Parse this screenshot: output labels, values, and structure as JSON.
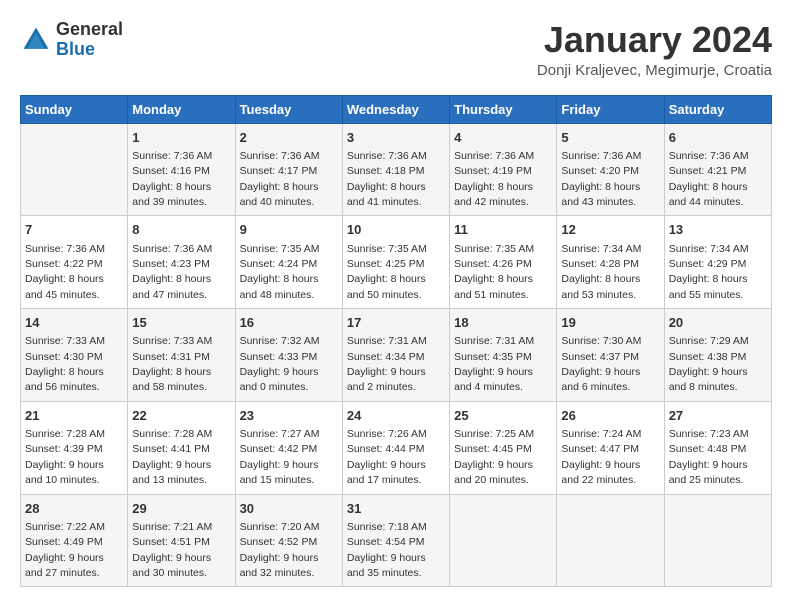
{
  "header": {
    "logo": {
      "general": "General",
      "blue": "Blue"
    },
    "title": "January 2024",
    "subtitle": "Donji Kraljevec, Megimurje, Croatia"
  },
  "weekdays": [
    "Sunday",
    "Monday",
    "Tuesday",
    "Wednesday",
    "Thursday",
    "Friday",
    "Saturday"
  ],
  "weeks": [
    [
      {
        "day": "",
        "sunrise": "",
        "sunset": "",
        "daylight": ""
      },
      {
        "day": "1",
        "sunrise": "Sunrise: 7:36 AM",
        "sunset": "Sunset: 4:16 PM",
        "daylight": "Daylight: 8 hours and 39 minutes."
      },
      {
        "day": "2",
        "sunrise": "Sunrise: 7:36 AM",
        "sunset": "Sunset: 4:17 PM",
        "daylight": "Daylight: 8 hours and 40 minutes."
      },
      {
        "day": "3",
        "sunrise": "Sunrise: 7:36 AM",
        "sunset": "Sunset: 4:18 PM",
        "daylight": "Daylight: 8 hours and 41 minutes."
      },
      {
        "day": "4",
        "sunrise": "Sunrise: 7:36 AM",
        "sunset": "Sunset: 4:19 PM",
        "daylight": "Daylight: 8 hours and 42 minutes."
      },
      {
        "day": "5",
        "sunrise": "Sunrise: 7:36 AM",
        "sunset": "Sunset: 4:20 PM",
        "daylight": "Daylight: 8 hours and 43 minutes."
      },
      {
        "day": "6",
        "sunrise": "Sunrise: 7:36 AM",
        "sunset": "Sunset: 4:21 PM",
        "daylight": "Daylight: 8 hours and 44 minutes."
      }
    ],
    [
      {
        "day": "7",
        "sunrise": "Sunrise: 7:36 AM",
        "sunset": "Sunset: 4:22 PM",
        "daylight": "Daylight: 8 hours and 45 minutes."
      },
      {
        "day": "8",
        "sunrise": "Sunrise: 7:36 AM",
        "sunset": "Sunset: 4:23 PM",
        "daylight": "Daylight: 8 hours and 47 minutes."
      },
      {
        "day": "9",
        "sunrise": "Sunrise: 7:35 AM",
        "sunset": "Sunset: 4:24 PM",
        "daylight": "Daylight: 8 hours and 48 minutes."
      },
      {
        "day": "10",
        "sunrise": "Sunrise: 7:35 AM",
        "sunset": "Sunset: 4:25 PM",
        "daylight": "Daylight: 8 hours and 50 minutes."
      },
      {
        "day": "11",
        "sunrise": "Sunrise: 7:35 AM",
        "sunset": "Sunset: 4:26 PM",
        "daylight": "Daylight: 8 hours and 51 minutes."
      },
      {
        "day": "12",
        "sunrise": "Sunrise: 7:34 AM",
        "sunset": "Sunset: 4:28 PM",
        "daylight": "Daylight: 8 hours and 53 minutes."
      },
      {
        "day": "13",
        "sunrise": "Sunrise: 7:34 AM",
        "sunset": "Sunset: 4:29 PM",
        "daylight": "Daylight: 8 hours and 55 minutes."
      }
    ],
    [
      {
        "day": "14",
        "sunrise": "Sunrise: 7:33 AM",
        "sunset": "Sunset: 4:30 PM",
        "daylight": "Daylight: 8 hours and 56 minutes."
      },
      {
        "day": "15",
        "sunrise": "Sunrise: 7:33 AM",
        "sunset": "Sunset: 4:31 PM",
        "daylight": "Daylight: 8 hours and 58 minutes."
      },
      {
        "day": "16",
        "sunrise": "Sunrise: 7:32 AM",
        "sunset": "Sunset: 4:33 PM",
        "daylight": "Daylight: 9 hours and 0 minutes."
      },
      {
        "day": "17",
        "sunrise": "Sunrise: 7:31 AM",
        "sunset": "Sunset: 4:34 PM",
        "daylight": "Daylight: 9 hours and 2 minutes."
      },
      {
        "day": "18",
        "sunrise": "Sunrise: 7:31 AM",
        "sunset": "Sunset: 4:35 PM",
        "daylight": "Daylight: 9 hours and 4 minutes."
      },
      {
        "day": "19",
        "sunrise": "Sunrise: 7:30 AM",
        "sunset": "Sunset: 4:37 PM",
        "daylight": "Daylight: 9 hours and 6 minutes."
      },
      {
        "day": "20",
        "sunrise": "Sunrise: 7:29 AM",
        "sunset": "Sunset: 4:38 PM",
        "daylight": "Daylight: 9 hours and 8 minutes."
      }
    ],
    [
      {
        "day": "21",
        "sunrise": "Sunrise: 7:28 AM",
        "sunset": "Sunset: 4:39 PM",
        "daylight": "Daylight: 9 hours and 10 minutes."
      },
      {
        "day": "22",
        "sunrise": "Sunrise: 7:28 AM",
        "sunset": "Sunset: 4:41 PM",
        "daylight": "Daylight: 9 hours and 13 minutes."
      },
      {
        "day": "23",
        "sunrise": "Sunrise: 7:27 AM",
        "sunset": "Sunset: 4:42 PM",
        "daylight": "Daylight: 9 hours and 15 minutes."
      },
      {
        "day": "24",
        "sunrise": "Sunrise: 7:26 AM",
        "sunset": "Sunset: 4:44 PM",
        "daylight": "Daylight: 9 hours and 17 minutes."
      },
      {
        "day": "25",
        "sunrise": "Sunrise: 7:25 AM",
        "sunset": "Sunset: 4:45 PM",
        "daylight": "Daylight: 9 hours and 20 minutes."
      },
      {
        "day": "26",
        "sunrise": "Sunrise: 7:24 AM",
        "sunset": "Sunset: 4:47 PM",
        "daylight": "Daylight: 9 hours and 22 minutes."
      },
      {
        "day": "27",
        "sunrise": "Sunrise: 7:23 AM",
        "sunset": "Sunset: 4:48 PM",
        "daylight": "Daylight: 9 hours and 25 minutes."
      }
    ],
    [
      {
        "day": "28",
        "sunrise": "Sunrise: 7:22 AM",
        "sunset": "Sunset: 4:49 PM",
        "daylight": "Daylight: 9 hours and 27 minutes."
      },
      {
        "day": "29",
        "sunrise": "Sunrise: 7:21 AM",
        "sunset": "Sunset: 4:51 PM",
        "daylight": "Daylight: 9 hours and 30 minutes."
      },
      {
        "day": "30",
        "sunrise": "Sunrise: 7:20 AM",
        "sunset": "Sunset: 4:52 PM",
        "daylight": "Daylight: 9 hours and 32 minutes."
      },
      {
        "day": "31",
        "sunrise": "Sunrise: 7:18 AM",
        "sunset": "Sunset: 4:54 PM",
        "daylight": "Daylight: 9 hours and 35 minutes."
      },
      {
        "day": "",
        "sunrise": "",
        "sunset": "",
        "daylight": ""
      },
      {
        "day": "",
        "sunrise": "",
        "sunset": "",
        "daylight": ""
      },
      {
        "day": "",
        "sunrise": "",
        "sunset": "",
        "daylight": ""
      }
    ]
  ]
}
